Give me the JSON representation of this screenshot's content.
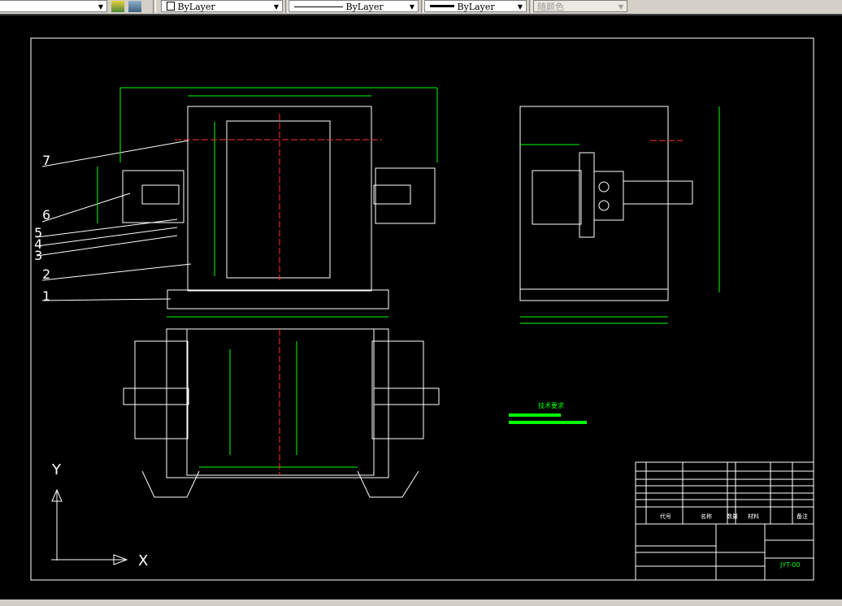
{
  "toolbar": {
    "layer_icons": [
      "layer-states-icon",
      "layer-previous-icon"
    ],
    "color_value": "ByLayer",
    "linetype_value": "ByLayer",
    "lineweight_value": "ByLayer",
    "plotstyle_value": "随颜色"
  },
  "drawing": {
    "balloons": [
      "7",
      "6",
      "5",
      "4",
      "3",
      "2",
      "1"
    ],
    "ucs": {
      "x_label": "X",
      "y_label": "Y"
    },
    "tech_requirements_title": "技术要求",
    "title_block": {
      "headers": [
        "代号",
        "名称",
        "数量",
        "材料",
        "备注"
      ],
      "drawing_number": "JYT-00"
    },
    "colors": {
      "background": "#000000",
      "outline": "#ffffff",
      "dimension": "#00ff00",
      "centerline": "#ff0000",
      "text": "#00ff00"
    }
  }
}
